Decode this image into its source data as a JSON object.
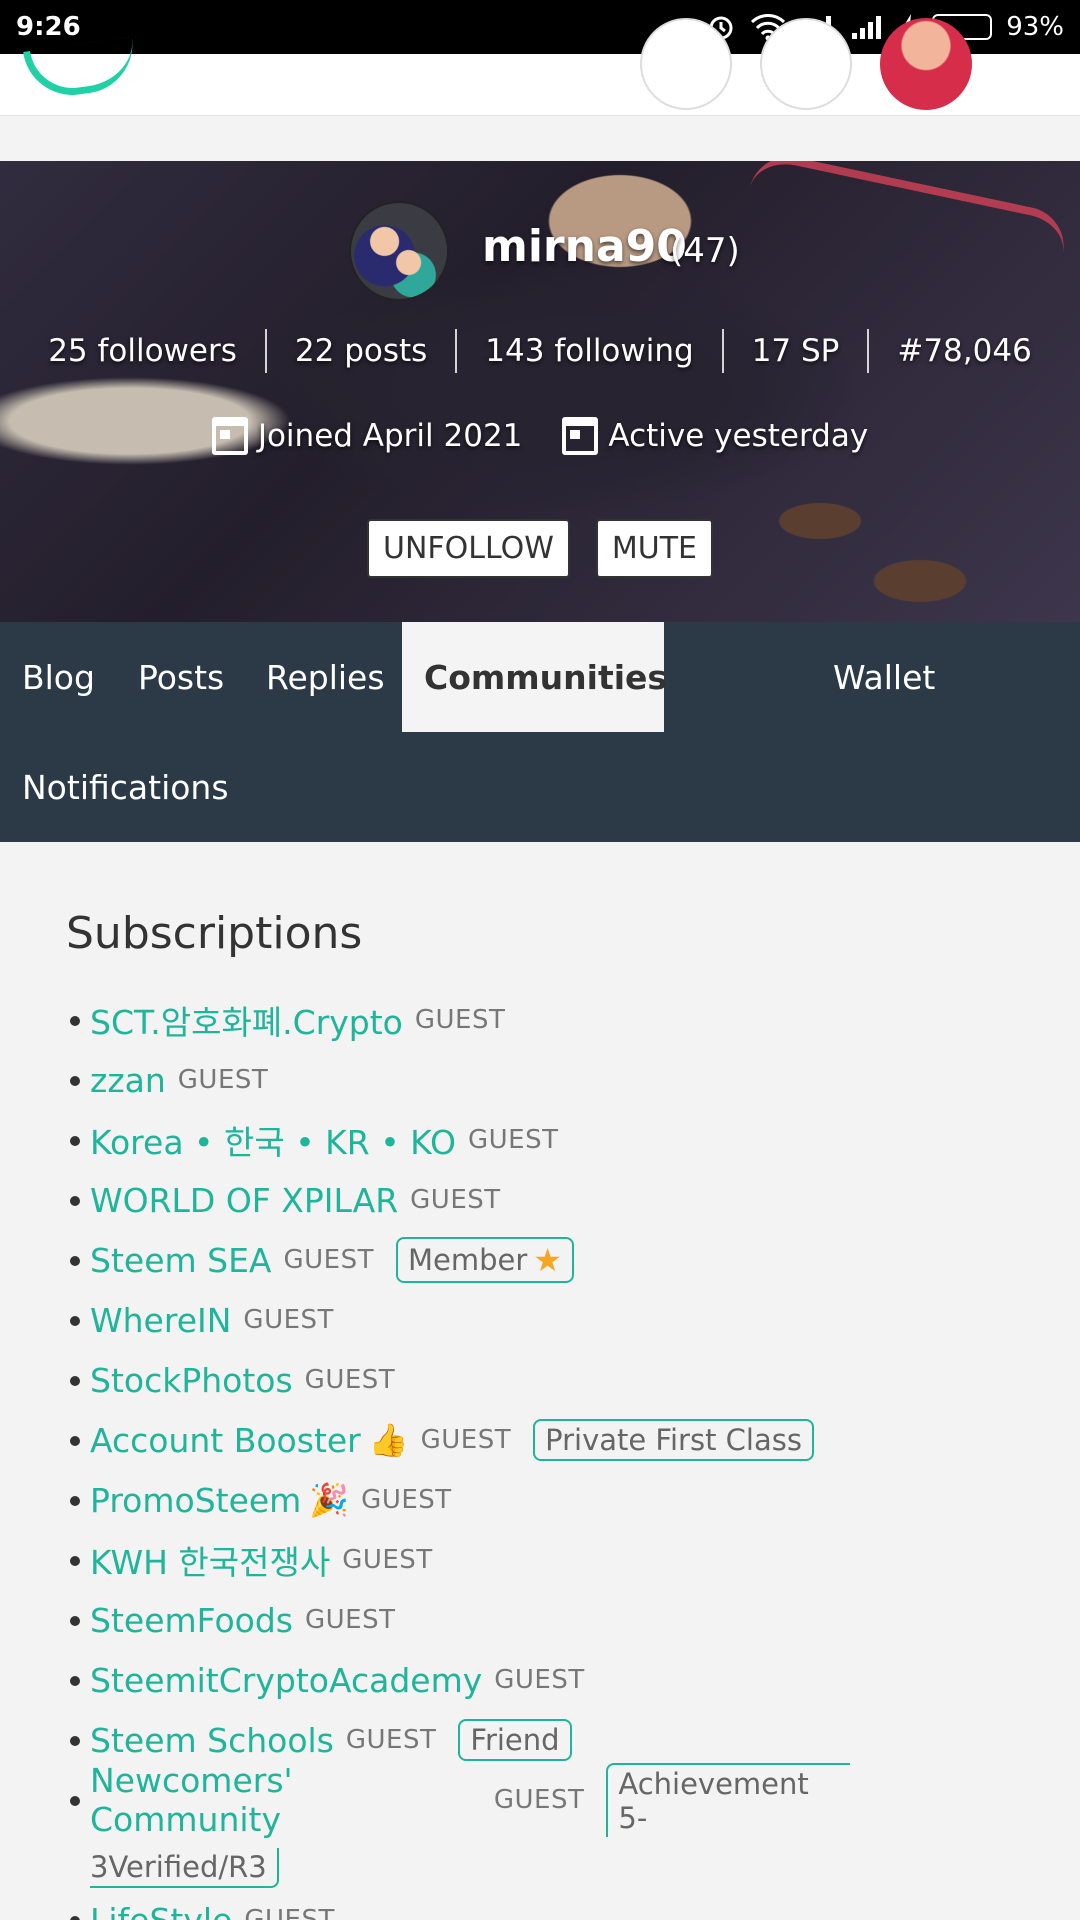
{
  "status_bar": {
    "time": "9:26",
    "dots": "...",
    "battery": "93%"
  },
  "profile": {
    "username": "mirna90",
    "reputation": "(47)",
    "stats": [
      "25 followers",
      "22 posts",
      "143 following",
      "17 SP",
      "#78,046"
    ],
    "joined": "Joined April 2021",
    "active": "Active yesterday",
    "unfollow_label": "UNFOLLOW",
    "mute_label": "MUTE"
  },
  "tabs": {
    "blog": "Blog",
    "posts": "Posts",
    "replies": "Replies",
    "communities": "Communities",
    "wallet": "Wallet",
    "notifications": "Notifications"
  },
  "subscriptions": {
    "title": "Subscriptions",
    "guest_label": "GUEST",
    "items": [
      {
        "name": "SCT.암호화폐.Crypto"
      },
      {
        "name": "zzan"
      },
      {
        "name": "Korea • 한국 • KR • KO"
      },
      {
        "name": "WORLD OF XPILAR"
      },
      {
        "name": "Steem SEA",
        "badge": "Member"
      },
      {
        "name": "WhereIN"
      },
      {
        "name": "StockPhotos"
      },
      {
        "name": "Account Booster",
        "badge": "Private First Class"
      },
      {
        "name": "PromoSteem"
      },
      {
        "name": "KWH 한국전쟁사"
      },
      {
        "name": "SteemFoods"
      },
      {
        "name": "SteemitCryptoAcademy"
      },
      {
        "name": "Steem Schools",
        "badge": "Friend"
      },
      {
        "name": "Newcomers' Community",
        "badge_line1": "Achievement 5-",
        "badge_line2": "3Verified/R3"
      },
      {
        "name": "LifeStyle"
      }
    ]
  },
  "colors": {
    "accent": "#1fb59a",
    "tab_bar": "#2c3a47",
    "logo": "#1fd1a5"
  }
}
